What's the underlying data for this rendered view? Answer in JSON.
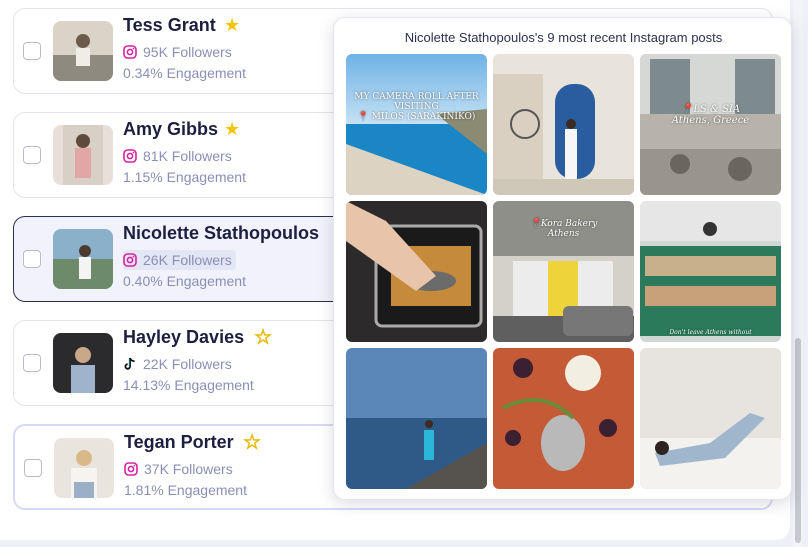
{
  "influencers": [
    {
      "name": "Tess Grant",
      "platform": "instagram",
      "followers": "95K Followers",
      "engagement": "0.34% Engagement",
      "star": "filled"
    },
    {
      "name": "Amy Gibbs",
      "platform": "instagram",
      "followers": "81K Followers",
      "engagement": "1.15% Engagement",
      "star": "filled"
    },
    {
      "name": "Nicolette Stathopoulos",
      "platform": "instagram",
      "followers": "26K Followers",
      "engagement": "0.40% Engagement",
      "star": "none"
    },
    {
      "name": "Hayley Davies",
      "platform": "tiktok",
      "followers": "22K Followers",
      "engagement": "14.13% Engagement",
      "star": "outline"
    },
    {
      "name": "Tegan Porter",
      "platform": "instagram",
      "followers": "37K Followers",
      "engagement": "1.81% Engagement",
      "star": "outline"
    }
  ],
  "popup": {
    "title": "Nicolette Stathopoulos's 9 most recent Instagram posts",
    "posts": [
      {
        "caption": "MY CAMERA ROLL AFTER VISITING\n📍 MILOS (SARAKINIKO)"
      },
      {
        "caption": ""
      },
      {
        "caption": "📍LS & SIA\nAthens, Greece"
      },
      {
        "caption": ""
      },
      {
        "caption": "📍Kora Bakery\nAthens"
      },
      {
        "caption": "Don't leave Athens without"
      },
      {
        "caption": ""
      },
      {
        "caption": ""
      },
      {
        "caption": ""
      }
    ]
  },
  "colors": {
    "accent": "#1d1f3f",
    "muted": "#8a8fb3",
    "star": "#f5c400",
    "instagram": "#d6249f"
  }
}
